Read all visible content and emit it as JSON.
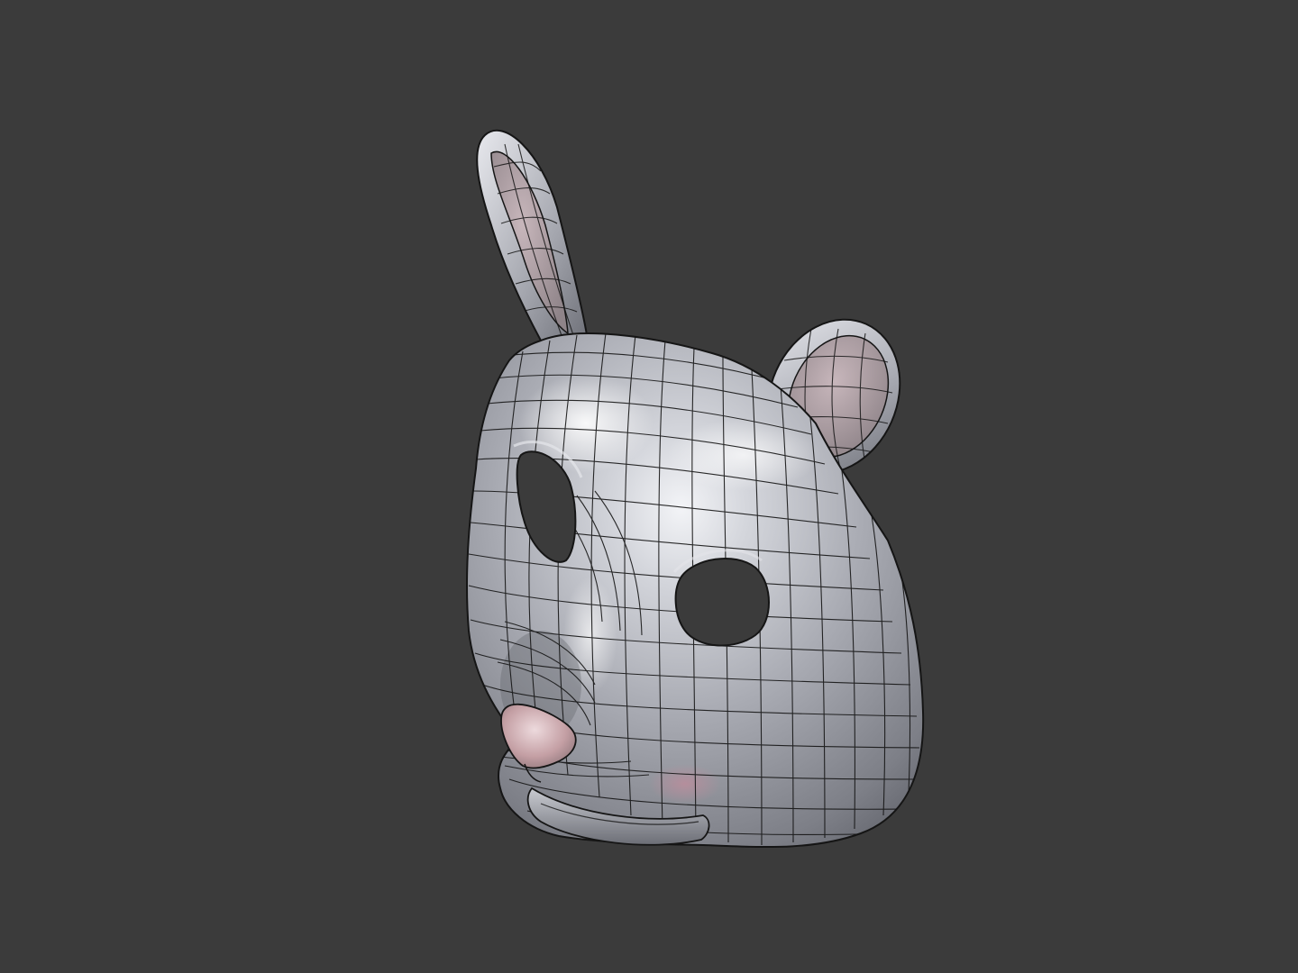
{
  "scene": {
    "background_color": "#3b3b3b",
    "object": {
      "kind": "animal-face-mask",
      "surface_color": "#a9abb2",
      "highlight_color": "#f2f3f6",
      "shadow_color": "#63656d",
      "inner_ear_color": "#b7a6ab",
      "nose_color": "#c6a2a6",
      "cheek_color": "#b58f9a",
      "wire_color": "#151515"
    }
  }
}
